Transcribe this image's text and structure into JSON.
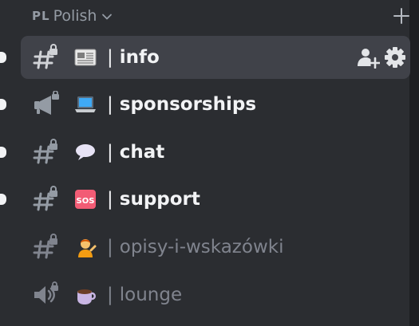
{
  "category": {
    "prefix": "PL",
    "name": "Polish",
    "chevron_icon": "chevron-down-icon",
    "add_icon": "plus-icon"
  },
  "channels": [
    {
      "separator": "|",
      "name": "info",
      "type_icon": "text-channel-locked-icon",
      "emoji": "newspaper",
      "state": "selected",
      "actions": [
        "invite-member-icon",
        "gear-icon"
      ]
    },
    {
      "separator": "|",
      "name": "sponsorships",
      "type_icon": "announcement-channel-icon",
      "emoji": "laptop",
      "state": "unread"
    },
    {
      "separator": "|",
      "name": "chat",
      "type_icon": "text-channel-locked-icon",
      "emoji": "speech-balloon",
      "state": "unread"
    },
    {
      "separator": "|",
      "name": "support",
      "type_icon": "text-channel-locked-icon",
      "emoji": "sos-button",
      "state": "unread"
    },
    {
      "separator": "|",
      "name": "opisy-i-wskazówki",
      "type_icon": "text-channel-locked-icon",
      "emoji": "person-tipping-hand",
      "state": "read"
    },
    {
      "separator": "|",
      "name": "lounge",
      "type_icon": "voice-channel-locked-icon",
      "emoji": "hot-beverage",
      "state": "read"
    }
  ],
  "colors": {
    "background": "#2b2d31",
    "selected_row": "#404249",
    "text_active": "#f2f3f5",
    "text_muted": "#80848e",
    "category_text": "#949ba4"
  }
}
